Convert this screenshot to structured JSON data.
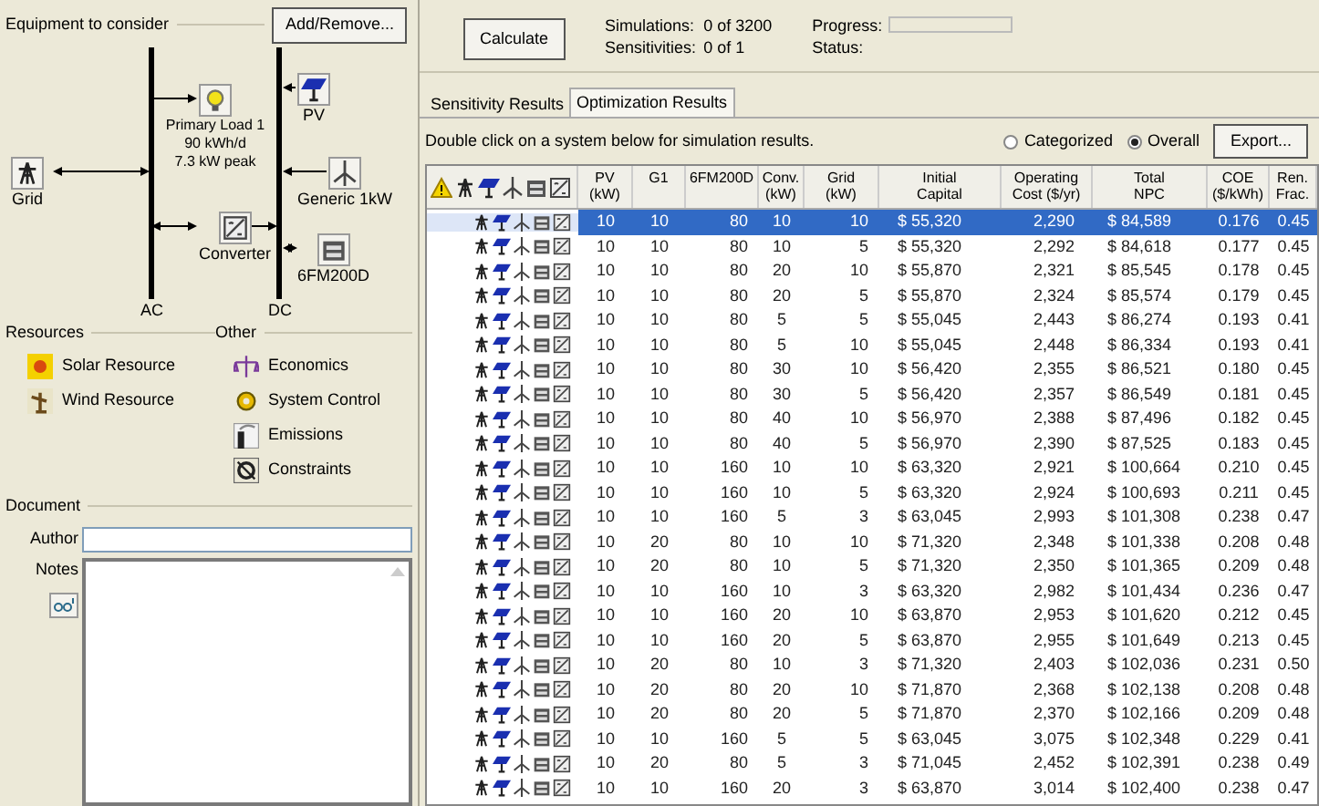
{
  "equipment": {
    "title": "Equipment to consider",
    "add_remove_button": "Add/Remove...",
    "buses": [
      {
        "kind": "ac",
        "label": "AC"
      },
      {
        "kind": "dc",
        "label": "DC"
      }
    ],
    "components": [
      {
        "kind": "load",
        "lines": [
          "Primary Load 1",
          "90 kWh/d",
          "7.3 kW peak"
        ]
      },
      {
        "kind": "pv",
        "lines": [
          "PV"
        ]
      },
      {
        "kind": "grid",
        "lines": [
          "Grid"
        ]
      },
      {
        "kind": "wind",
        "lines": [
          "Generic 1kW"
        ]
      },
      {
        "kind": "converter",
        "lines": [
          "Converter"
        ]
      },
      {
        "kind": "battery",
        "lines": [
          "6FM200D"
        ]
      }
    ]
  },
  "resources": {
    "title": "Resources",
    "items": [
      {
        "kind": "solar",
        "label": "Solar Resource"
      },
      {
        "kind": "wind",
        "label": "Wind Resource"
      }
    ]
  },
  "other": {
    "title": "Other",
    "items": [
      {
        "kind": "economics",
        "label": "Economics"
      },
      {
        "kind": "system_control",
        "label": "System Control"
      },
      {
        "kind": "emissions",
        "label": "Emissions"
      },
      {
        "kind": "constraints",
        "label": "Constraints"
      }
    ]
  },
  "document": {
    "title": "Document",
    "author_label": "Author",
    "notes_label": "Notes"
  },
  "toolbar": {
    "calculate_button": "Calculate",
    "simulations_label": "Simulations:",
    "simulations_value": "0 of 3200",
    "sensitivities_label": "Sensitivities:",
    "sensitivities_value": "0 of 1",
    "progress_label": "Progress:",
    "status_label": "Status:"
  },
  "tabs": [
    {
      "label": "Sensitivity Results",
      "selected": false
    },
    {
      "label": "Optimization Results",
      "selected": true
    }
  ],
  "results": {
    "hint": "Double click on a system below for simulation results.",
    "view_options": [
      {
        "label": "Categorized",
        "selected": false
      },
      {
        "label": "Overall",
        "selected": true
      }
    ],
    "export_button": "Export...",
    "table": {
      "columns": [
        "PV\n(kW)",
        "G1",
        "6FM200D",
        "Conv.\n(kW)",
        "Grid\n(kW)",
        "Initial\nCapital",
        "Operating\nCost ($/yr)",
        "Total\nNPC",
        "COE\n($/kWh)",
        "Ren.\nFrac."
      ],
      "rows": [
        {
          "selected": true,
          "cells": [
            "10",
            "10",
            "80",
            "10",
            "10",
            "$ 55,320",
            "2,290",
            "$ 84,589",
            "0.176",
            "0.45"
          ]
        },
        {
          "selected": false,
          "cells": [
            "10",
            "10",
            "80",
            "10",
            "5",
            "$ 55,320",
            "2,292",
            "$ 84,618",
            "0.177",
            "0.45"
          ]
        },
        {
          "selected": false,
          "cells": [
            "10",
            "10",
            "80",
            "20",
            "10",
            "$ 55,870",
            "2,321",
            "$ 85,545",
            "0.178",
            "0.45"
          ]
        },
        {
          "selected": false,
          "cells": [
            "10",
            "10",
            "80",
            "20",
            "5",
            "$ 55,870",
            "2,324",
            "$ 85,574",
            "0.179",
            "0.45"
          ]
        },
        {
          "selected": false,
          "cells": [
            "10",
            "10",
            "80",
            "5",
            "5",
            "$ 55,045",
            "2,443",
            "$ 86,274",
            "0.193",
            "0.41"
          ]
        },
        {
          "selected": false,
          "cells": [
            "10",
            "10",
            "80",
            "5",
            "10",
            "$ 55,045",
            "2,448",
            "$ 86,334",
            "0.193",
            "0.41"
          ]
        },
        {
          "selected": false,
          "cells": [
            "10",
            "10",
            "80",
            "30",
            "10",
            "$ 56,420",
            "2,355",
            "$ 86,521",
            "0.180",
            "0.45"
          ]
        },
        {
          "selected": false,
          "cells": [
            "10",
            "10",
            "80",
            "30",
            "5",
            "$ 56,420",
            "2,357",
            "$ 86,549",
            "0.181",
            "0.45"
          ]
        },
        {
          "selected": false,
          "cells": [
            "10",
            "10",
            "80",
            "40",
            "10",
            "$ 56,970",
            "2,388",
            "$ 87,496",
            "0.182",
            "0.45"
          ]
        },
        {
          "selected": false,
          "cells": [
            "10",
            "10",
            "80",
            "40",
            "5",
            "$ 56,970",
            "2,390",
            "$ 87,525",
            "0.183",
            "0.45"
          ]
        },
        {
          "selected": false,
          "cells": [
            "10",
            "10",
            "160",
            "10",
            "10",
            "$ 63,320",
            "2,921",
            "$ 100,664",
            "0.210",
            "0.45"
          ]
        },
        {
          "selected": false,
          "cells": [
            "10",
            "10",
            "160",
            "10",
            "5",
            "$ 63,320",
            "2,924",
            "$ 100,693",
            "0.211",
            "0.45"
          ]
        },
        {
          "selected": false,
          "cells": [
            "10",
            "10",
            "160",
            "5",
            "3",
            "$ 63,045",
            "2,993",
            "$ 101,308",
            "0.238",
            "0.47"
          ]
        },
        {
          "selected": false,
          "cells": [
            "10",
            "20",
            "80",
            "10",
            "10",
            "$ 71,320",
            "2,348",
            "$ 101,338",
            "0.208",
            "0.48"
          ]
        },
        {
          "selected": false,
          "cells": [
            "10",
            "20",
            "80",
            "10",
            "5",
            "$ 71,320",
            "2,350",
            "$ 101,365",
            "0.209",
            "0.48"
          ]
        },
        {
          "selected": false,
          "cells": [
            "10",
            "10",
            "160",
            "10",
            "3",
            "$ 63,320",
            "2,982",
            "$ 101,434",
            "0.236",
            "0.47"
          ]
        },
        {
          "selected": false,
          "cells": [
            "10",
            "10",
            "160",
            "20",
            "10",
            "$ 63,870",
            "2,953",
            "$ 101,620",
            "0.212",
            "0.45"
          ]
        },
        {
          "selected": false,
          "cells": [
            "10",
            "10",
            "160",
            "20",
            "5",
            "$ 63,870",
            "2,955",
            "$ 101,649",
            "0.213",
            "0.45"
          ]
        },
        {
          "selected": false,
          "cells": [
            "10",
            "20",
            "80",
            "10",
            "3",
            "$ 71,320",
            "2,403",
            "$ 102,036",
            "0.231",
            "0.50"
          ]
        },
        {
          "selected": false,
          "cells": [
            "10",
            "20",
            "80",
            "20",
            "10",
            "$ 71,870",
            "2,368",
            "$ 102,138",
            "0.208",
            "0.48"
          ]
        },
        {
          "selected": false,
          "cells": [
            "10",
            "20",
            "80",
            "20",
            "5",
            "$ 71,870",
            "2,370",
            "$ 102,166",
            "0.209",
            "0.48"
          ]
        },
        {
          "selected": false,
          "cells": [
            "10",
            "10",
            "160",
            "5",
            "5",
            "$ 63,045",
            "3,075",
            "$ 102,348",
            "0.229",
            "0.41"
          ]
        },
        {
          "selected": false,
          "cells": [
            "10",
            "20",
            "80",
            "5",
            "3",
            "$ 71,045",
            "2,452",
            "$ 102,391",
            "0.238",
            "0.49"
          ]
        },
        {
          "selected": false,
          "cells": [
            "10",
            "10",
            "160",
            "20",
            "3",
            "$ 63,870",
            "3,014",
            "$ 102,400",
            "0.238",
            "0.47"
          ]
        }
      ]
    }
  }
}
